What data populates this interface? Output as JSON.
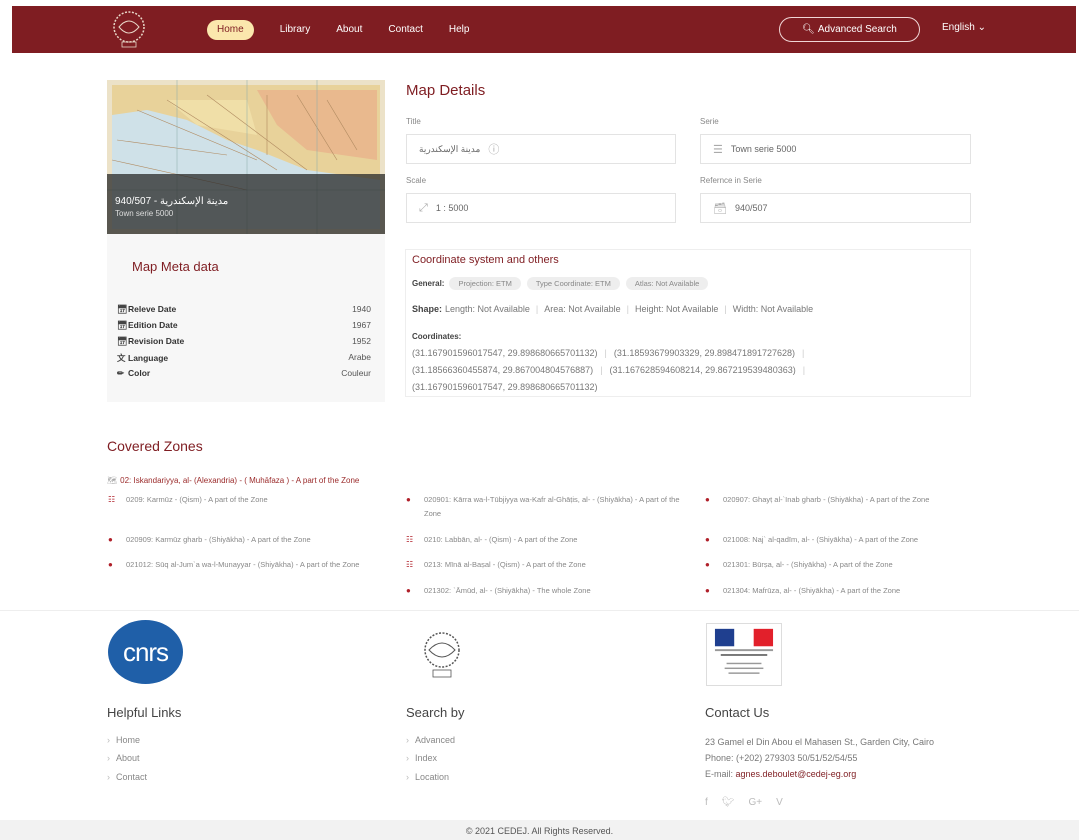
{
  "nav": {
    "links": [
      "Home",
      "Library",
      "About",
      "Contact",
      "Help"
    ],
    "advanced_search": "Advanced Search",
    "language": "English"
  },
  "map_preview": {
    "caption_title": "مدينة الإسكندرية - 940/507",
    "caption_serie": "Town serie 5000"
  },
  "meta": {
    "title": "Map Meta data",
    "rows": [
      {
        "label": "Releve Date",
        "value": "1940",
        "icon": "calendar-icon"
      },
      {
        "label": "Edition Date",
        "value": "1967",
        "icon": "calendar-icon"
      },
      {
        "label": "Revision Date",
        "value": "1952",
        "icon": "calendar-icon"
      },
      {
        "label": "Language",
        "value": "Arabe",
        "icon": "translate-icon"
      },
      {
        "label": "Color",
        "value": "Couleur",
        "icon": "brush-icon"
      }
    ]
  },
  "details": {
    "title": "Map Details",
    "title_label": "Title",
    "title_value": "مدينة الإسكندرية",
    "serie_label": "Serie",
    "serie_value": "Town serie 5000",
    "scale_label": "Scale",
    "scale_value": "1 : 5000",
    "ref_label": "Refernce in Serie",
    "ref_value": "940/507"
  },
  "coord": {
    "title": "Coordinate system and others",
    "general_label": "General:",
    "chips": [
      "Projection: ETM",
      "Type Coordinate: ETM",
      "Atlas: Not Available"
    ],
    "shape_label": "Shape:",
    "shape_items": [
      "Length: Not Available",
      "Area: Not Available",
      "Height: Not Available",
      "Width: Not Available"
    ],
    "coords_label": "Coordinates:",
    "coords": [
      "(31.167901596017547, 29.898680665701132)",
      "(31.18593679903329, 29.898471891727628)",
      "(31.18566360455874, 29.867004804576887)",
      "(31.167628594608214, 29.867219539480363)",
      "(31.167901596017547, 29.898680665701132)"
    ]
  },
  "zones": {
    "title": "Covered Zones",
    "head": "02: Iskandariyya, al- (Alexandria) - ( Muhāfaza ) - A part of the Zone",
    "items": [
      {
        "text": "0209: Karmūz - (Qism) - A part of the Zone",
        "icon": "building-icon"
      },
      {
        "text": "020901: Kārra wa-l-Tūbjiyya wa-Kafr al-Ghāṭis, al- - (Shiyākha) - A part of the Zone",
        "icon": "pin-icon"
      },
      {
        "text": "020907: Ghayṭ al-`Inab gharb - (Shiyākha) - A part of the Zone",
        "icon": "pin-icon"
      },
      {
        "text": "020909: Karmūz gharb - (Shiyākha) - A part of the Zone",
        "icon": "pin-icon"
      },
      {
        "text": "0210: Labbān, al- - (Qism) - A part of the Zone",
        "icon": "building-icon"
      },
      {
        "text": "021008: Naj` al-qadīm, al- - (Shiyākha) - A part of the Zone",
        "icon": "pin-icon"
      },
      {
        "text": "021012: Sūq al-Jum`a wa-l-Munayyar - (Shiyākha) - A part of the Zone",
        "icon": "pin-icon"
      },
      {
        "text": "0213: Mīnā al-Baṣal - (Qism) - A part of the Zone",
        "icon": "building-icon"
      },
      {
        "text": "021301: Būrṣa, al- - (Shiyākha) - A part of the Zone",
        "icon": "pin-icon"
      },
      {
        "text": "021302: `Āmūd, al- - (Shiyākha) - The whole Zone",
        "icon": "pin-icon"
      },
      {
        "text": "021304: Mafrūza, al- - (Shiyākha) - A part of the Zone",
        "icon": "pin-icon"
      }
    ]
  },
  "footer": {
    "cnrs_logo": "cnrs",
    "helpful_title": "Helpful Links",
    "helpful": [
      "Home",
      "About",
      "Contact"
    ],
    "search_title": "Search by",
    "search": [
      "Advanced",
      "Index",
      "Location"
    ],
    "contact_title": "Contact Us",
    "address": "23 Gamel el Din Abou el Mahasen St., Garden City, Cairo",
    "phone": "Phone: (+202) 279303 50/51/52/54/55",
    "email_label": "E-mail:",
    "email": "agnes.deboulet@cedej-eg.org",
    "social": [
      "f",
      "🐦",
      "G+",
      "V"
    ],
    "copyright": "© 2021 CEDEJ. All Rights Reserved."
  },
  "colors": {
    "brand": "#7f1d22",
    "accent": "#fbe7ad"
  }
}
